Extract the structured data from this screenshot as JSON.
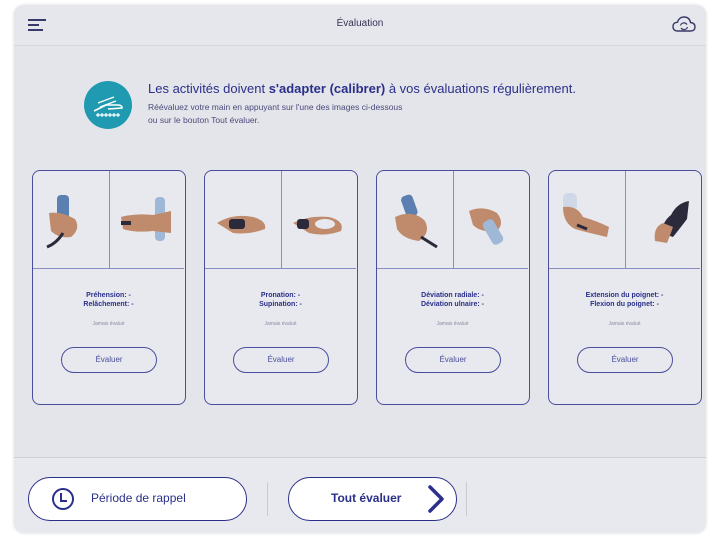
{
  "header": {
    "title": "Évaluation",
    "menu_icon": "menu-icon",
    "sync_icon": "cloud-sync-icon"
  },
  "intro": {
    "icon": "hand-measure-icon",
    "heading_prefix": "Les activités doivent ",
    "heading_bold": "s'adapter (calibrer)",
    "heading_suffix": " à vos évaluations régulièrement.",
    "line1": "Réévaluez votre main en appuyant sur l'une des images ci-dessous",
    "line2": "ou sur le bouton Tout évaluer."
  },
  "cards": [
    {
      "line1": "Préhension: -",
      "line2": "Relâchement: -",
      "sub": "Jamais évalué",
      "button": "Évaluer"
    },
    {
      "line1": "Pronation: -",
      "line2": "Supination: -",
      "sub": "Jamais évalué",
      "button": "Évaluer"
    },
    {
      "line1": "Déviation radiale: -",
      "line2": "Déviation ulnaire: -",
      "sub": "Jamais évalué",
      "button": "Évaluer"
    },
    {
      "line1": "Extension du poignet: -",
      "line2": "Flexion du poignet: -",
      "sub": "Jamais évalué",
      "button": "Évaluer"
    }
  ],
  "footer": {
    "rappel_label": "Période de rappel",
    "tout_label": "Tout évaluer",
    "clock_icon": "clock-icon",
    "chevron_icon": "chevron-right-icon"
  },
  "colors": {
    "accent": "#2a2f8a",
    "badge": "#1f9ab0",
    "background": "#e4e5ea"
  }
}
